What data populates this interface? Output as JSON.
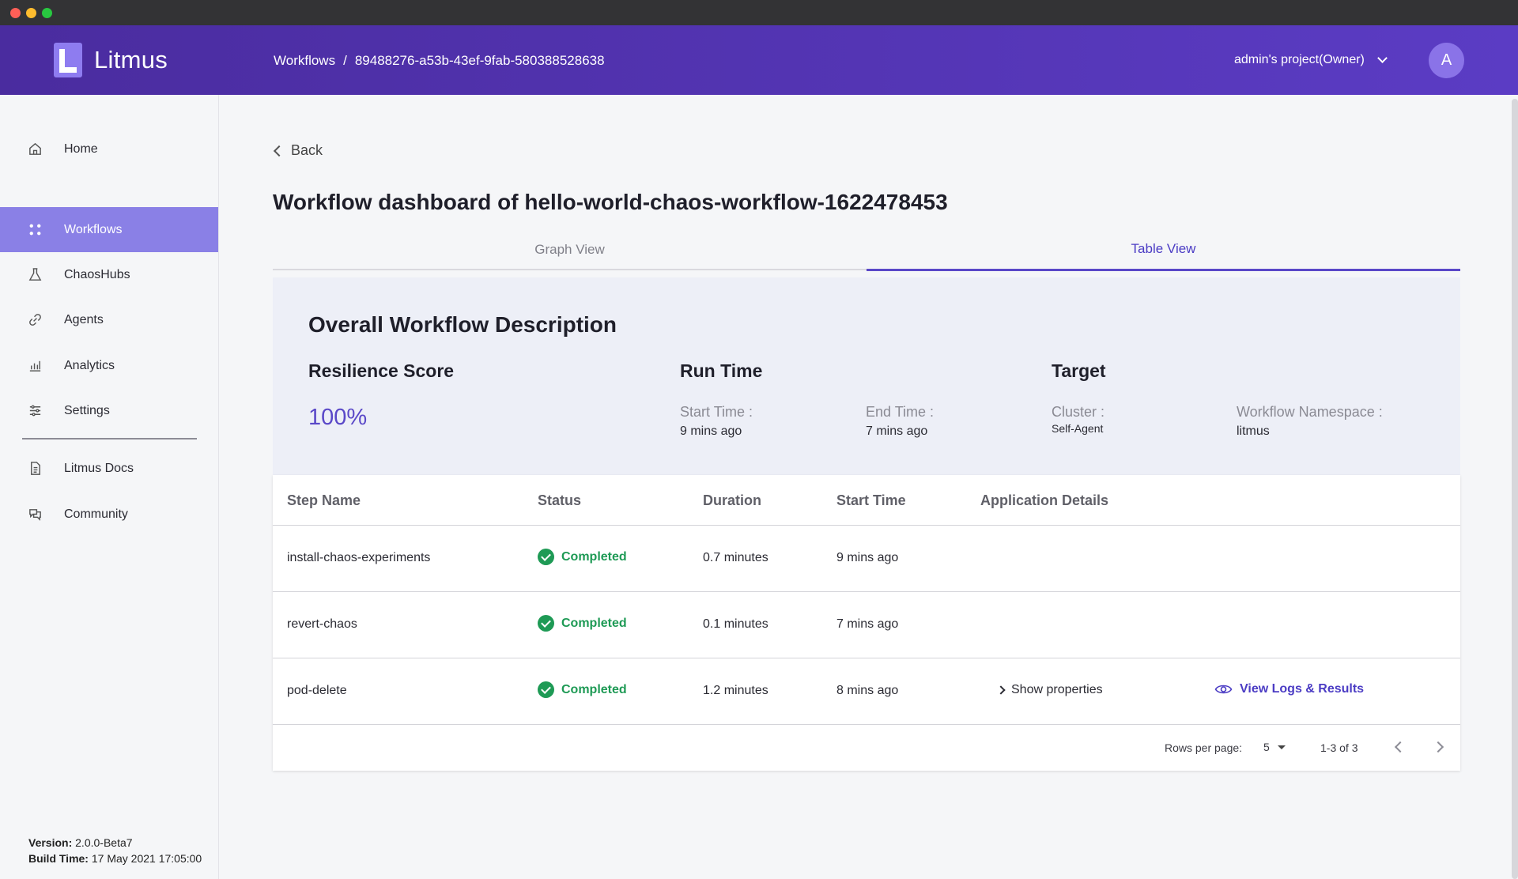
{
  "window": {
    "title_bar_dots": [
      "close",
      "minimize",
      "maximize"
    ]
  },
  "header": {
    "app_name": "Litmus",
    "breadcrumb": {
      "root": "Workflows",
      "separator": "/",
      "current": "89488276-a53b-43ef-9fab-580388528638"
    },
    "project": "admin's project(Owner)",
    "avatar_initial": "A",
    "colors": {
      "gradient_start": "#4a2c9f",
      "gradient_end": "#5b3cc4"
    }
  },
  "sidebar": {
    "items": [
      {
        "label": "Home",
        "icon": "home-icon"
      },
      {
        "label": "Workflows",
        "icon": "workflows-icon",
        "active": true
      },
      {
        "label": "ChaosHubs",
        "icon": "flask-icon"
      },
      {
        "label": "Agents",
        "icon": "link-icon"
      },
      {
        "label": "Analytics",
        "icon": "bar-chart-icon"
      },
      {
        "label": "Settings",
        "icon": "sliders-icon"
      },
      {
        "label": "Litmus Docs",
        "icon": "document-icon"
      },
      {
        "label": "Community",
        "icon": "chat-icon"
      }
    ],
    "version_label": "Version:",
    "version": "2.0.0-Beta7",
    "build_label": "Build Time:",
    "build_time": "17 May 2021 17:05:00",
    "active_color": "#8a80e6"
  },
  "main": {
    "back_label": "Back",
    "title": "Workflow dashboard of hello-world-chaos-workflow-1622478453",
    "tabs": [
      {
        "label": "Graph View",
        "active": false
      },
      {
        "label": "Table View",
        "active": true
      }
    ],
    "description": {
      "title": "Overall Workflow Description",
      "resilience_heading": "Resilience Score",
      "resilience_score": "100%",
      "runtime_heading": "Run Time",
      "start_time_label": "Start Time :",
      "start_time_value": "9 mins ago",
      "end_time_label": "End Time :",
      "end_time_value": "7 mins ago",
      "target_heading": "Target",
      "cluster_label": "Cluster :",
      "cluster_value": "Self-Agent",
      "namespace_label": "Workflow Namespace :",
      "namespace_value": "litmus"
    },
    "table": {
      "headers": [
        "Step Name",
        "Status",
        "Duration",
        "Start Time",
        "Application Details"
      ],
      "rows": [
        {
          "step": "install-chaos-experiments",
          "status": "Completed",
          "duration": "0.7 minutes",
          "start": "9 mins ago"
        },
        {
          "step": "revert-chaos",
          "status": "Completed",
          "duration": "0.1 minutes",
          "start": "7 mins ago"
        },
        {
          "step": "pod-delete",
          "status": "Completed",
          "duration": "1.2 minutes",
          "start": "8 mins ago",
          "details_link": "Show properties",
          "logs_link": "View Logs & Results"
        }
      ],
      "status_color": "#1e9a55"
    },
    "pagination": {
      "rows_per_page_label": "Rows per page:",
      "rows_per_page": "5",
      "range": "1-3 of 3"
    }
  }
}
